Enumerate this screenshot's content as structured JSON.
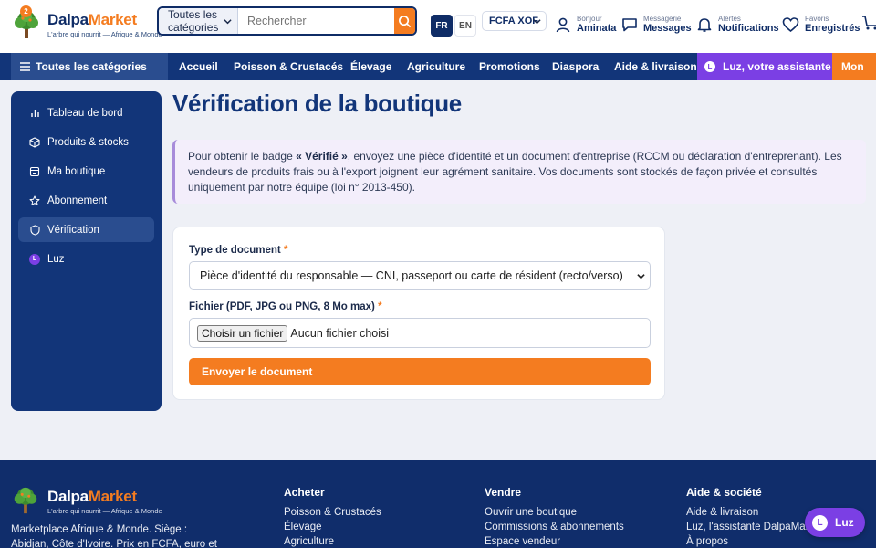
{
  "header": {
    "cart_badge": "2",
    "brand_a": "Dalpa",
    "brand_b": "Market",
    "tagline": "L'arbre qui nourrit — Afrique & Monde",
    "search": {
      "category": "Toutes les catégories",
      "placeholder": "Rechercher"
    },
    "lang": {
      "fr": "FR",
      "en": "EN"
    },
    "currency": "FCFA XOF",
    "account": {
      "small": "Bonjour",
      "big": "Aminata"
    },
    "messages": {
      "small": "Messagerie",
      "big": "Messages"
    },
    "alerts": {
      "small": "Alertes",
      "big": "Notifications"
    },
    "favorites": {
      "small": "Favoris",
      "big": "Enregistrés"
    }
  },
  "nav": {
    "all_categories": "Toutes les catégories",
    "links": [
      "Accueil",
      "Poisson & Crustacés",
      "Élevage",
      "Agriculture",
      "Promotions",
      "Diaspora",
      "Aide & livraison"
    ],
    "luz": "Luz, votre assistante",
    "luz_letter": "L",
    "more": "Mon"
  },
  "sidebar": {
    "items": [
      {
        "label": "Tableau de bord",
        "icon": "bar-chart-icon"
      },
      {
        "label": "Produits & stocks",
        "icon": "box-icon"
      },
      {
        "label": "Ma boutique",
        "icon": "shop-icon"
      },
      {
        "label": "Abonnement",
        "icon": "star-icon"
      },
      {
        "label": "Vérification",
        "icon": "shield-icon",
        "active": true
      },
      {
        "label": "Luz",
        "icon": "luz-icon"
      }
    ]
  },
  "main": {
    "title": "Vérification de la boutique",
    "info_pre": "Pour obtenir le badge ",
    "info_bold": "« Vérifié »",
    "info_post": ", envoyez une pièce d'identité et un document d'entreprise (RCCM ou déclaration d'entreprenant). Les vendeurs de produits frais ou à l'export joignent leur agrément sanitaire. Vos documents sont stockés de façon privée et consultés uniquement par notre équipe (loi n° 2013-450).",
    "form": {
      "doc_type_label": "Type de document",
      "required_mark": "*",
      "doc_type_value": "Pièce d'identité du responsable — CNI, passeport ou carte de résident (recto/verso)",
      "file_label": "Fichier (PDF, JPG ou PNG, 8 Mo max)",
      "file_button": "Choisir un fichier",
      "file_status": "Aucun fichier choisi",
      "submit": "Envoyer le document"
    }
  },
  "footer": {
    "brand_a": "Dalpa",
    "brand_b": "Market",
    "tagline": "L'arbre qui nourrit — Afrique & Monde",
    "description": "Marketplace Afrique & Monde. Siège : Abidjan, Côte d'Ivoire. Prix en FCFA, euro et",
    "columns": [
      {
        "title": "Acheter",
        "links": [
          "Poisson & Crustacés",
          "Élevage",
          "Agriculture"
        ]
      },
      {
        "title": "Vendre",
        "links": [
          "Ouvrir une boutique",
          "Commissions & abonnements",
          "Espace vendeur"
        ]
      },
      {
        "title": "Aide & société",
        "links": [
          "Aide & livraison",
          "Luz, l'assistante DalpaMarket",
          "À propos"
        ]
      }
    ],
    "luz_button": "Luz",
    "luz_letter": "L"
  },
  "colors": {
    "navy": "#123579",
    "orange": "#f47c20",
    "purple": "#7b3fe4",
    "background": "#eef0f6"
  }
}
